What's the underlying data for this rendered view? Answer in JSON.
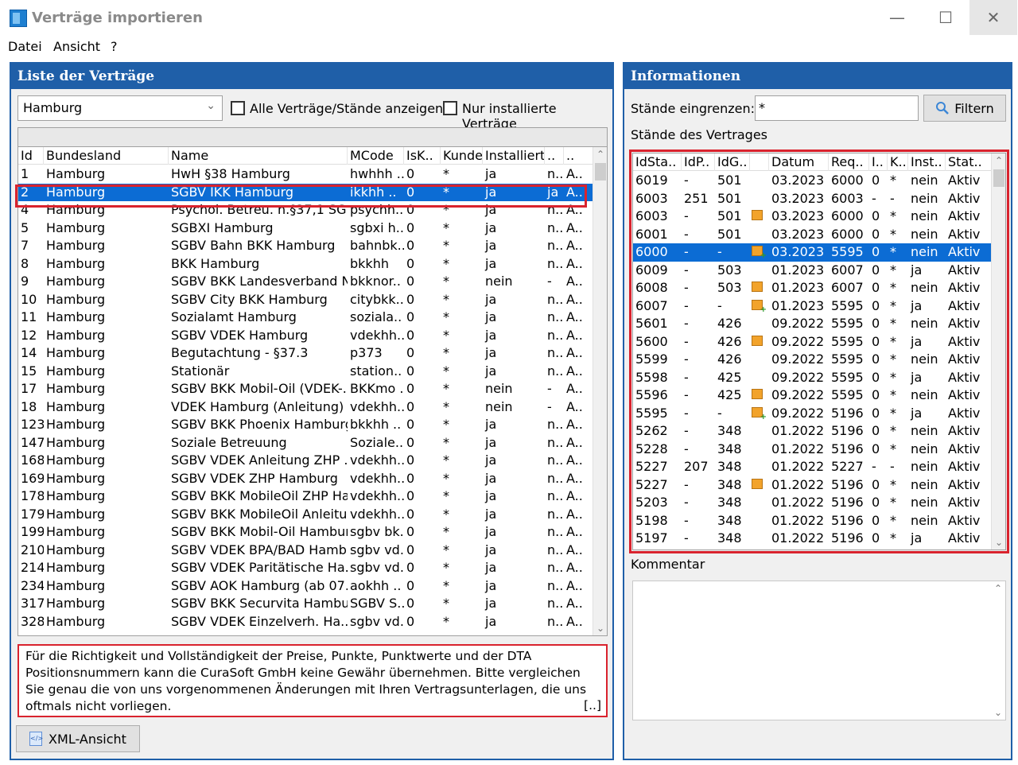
{
  "window": {
    "title": "Verträge importieren",
    "minimize": "—",
    "maximize": "☐",
    "close": "✕"
  },
  "menu": [
    "Datei",
    "Ansicht",
    "?"
  ],
  "left": {
    "header": "Liste der Verträge",
    "state_value": "Hamburg",
    "chk_all_label": "Alle Verträge/Stände anzeigen",
    "chk_installed_label": "Nur installierte Verträge",
    "columns": [
      "Id",
      "Bundesland",
      "Name",
      "MCode",
      "IsK..",
      "Kunde",
      "Installiert",
      "..",
      ".."
    ],
    "rows": [
      [
        "1",
        "Hamburg",
        "HwH §38 Hamburg",
        "hwhhh ..",
        "0",
        "*",
        "ja",
        "n..",
        "A.."
      ],
      [
        "2",
        "Hamburg",
        "SGBV IKK Hamburg",
        "ikkhh ..",
        "0",
        "*",
        "ja",
        "ja",
        "A.."
      ],
      [
        "4",
        "Hamburg",
        "Psychol. Betreu. n.§37,1 SG..",
        "psychh..",
        "0",
        "*",
        "ja",
        "n..",
        "A.."
      ],
      [
        "5",
        "Hamburg",
        "SGBXI Hamburg",
        "sgbxi h..",
        "0",
        "*",
        "ja",
        "n..",
        "A.."
      ],
      [
        "7",
        "Hamburg",
        "SGBV Bahn BKK Hamburg",
        "bahnbk..",
        "0",
        "*",
        "ja",
        "n..",
        "A.."
      ],
      [
        "8",
        "Hamburg",
        "BKK Hamburg",
        "bkkhh",
        "0",
        "*",
        "ja",
        "n..",
        "A.."
      ],
      [
        "9",
        "Hamburg",
        "SGBV BKK Landesverband N..",
        "bkknor..",
        "0",
        "*",
        "nein",
        "-",
        "A.."
      ],
      [
        "10",
        "Hamburg",
        "SGBV City BKK Hamburg",
        "citybkk..",
        "0",
        "*",
        "ja",
        "n..",
        "A.."
      ],
      [
        "11",
        "Hamburg",
        "Sozialamt Hamburg",
        "soziala..",
        "0",
        "*",
        "ja",
        "n..",
        "A.."
      ],
      [
        "12",
        "Hamburg",
        "SGBV VDEK Hamburg",
        "vdekhh..",
        "0",
        "*",
        "ja",
        "n..",
        "A.."
      ],
      [
        "14",
        "Hamburg",
        "Begutachtung - §37.3",
        "p373",
        "0",
        "*",
        "ja",
        "n..",
        "A.."
      ],
      [
        "15",
        "Hamburg",
        "Stationär",
        "station..",
        "0",
        "*",
        "ja",
        "n..",
        "A.."
      ],
      [
        "17",
        "Hamburg",
        "SGBV BKK Mobil-Oil (VDEK-..",
        "BKKmo ..",
        "0",
        "*",
        "nein",
        "-",
        "A.."
      ],
      [
        "18",
        "Hamburg",
        "VDEK Hamburg (Anleitung)",
        "vdekhh..",
        "0",
        "*",
        "nein",
        "-",
        "A.."
      ],
      [
        "123",
        "Hamburg",
        "SGBV BKK Phoenix Hamburg",
        "bkkhh ..",
        "0",
        "*",
        "ja",
        "n..",
        "A.."
      ],
      [
        "147",
        "Hamburg",
        "Soziale Betreuung",
        "Soziale..",
        "0",
        "*",
        "ja",
        "n..",
        "A.."
      ],
      [
        "168",
        "Hamburg",
        "SGBV VDEK Anleitung ZHP ..",
        "vdekhh..",
        "0",
        "*",
        "ja",
        "n..",
        "A.."
      ],
      [
        "169",
        "Hamburg",
        "SGBV VDEK ZHP Hamburg",
        "vdekhh..",
        "0",
        "*",
        "ja",
        "n..",
        "A.."
      ],
      [
        "178",
        "Hamburg",
        "SGBV BKK MobileOil ZHP Ha..",
        "vdekhh..",
        "0",
        "*",
        "ja",
        "n..",
        "A.."
      ],
      [
        "179",
        "Hamburg",
        "SGBV BKK MobileOil Anleitu..",
        "vdekhh..",
        "0",
        "*",
        "ja",
        "n..",
        "A.."
      ],
      [
        "199",
        "Hamburg",
        "SGBV BKK Mobil-Oil Hamburg",
        "sgbv bk..",
        "0",
        "*",
        "ja",
        "n..",
        "A.."
      ],
      [
        "210",
        "Hamburg",
        "SGBV VDEK BPA/BAD Hamb..",
        "sgbv vd..",
        "0",
        "*",
        "ja",
        "n..",
        "A.."
      ],
      [
        "214",
        "Hamburg",
        "SGBV VDEK Paritätische Ha..",
        "sgbv vd..",
        "0",
        "*",
        "ja",
        "n..",
        "A.."
      ],
      [
        "234",
        "Hamburg",
        "SGBV AOK Hamburg (ab 07..",
        "aokhh ..",
        "0",
        "*",
        "ja",
        "n..",
        "A.."
      ],
      [
        "317",
        "Hamburg",
        "SGBV BKK Securvita Hambu..",
        "SGBV S..",
        "0",
        "*",
        "ja",
        "n..",
        "A.."
      ],
      [
        "328",
        "Hamburg",
        "SGBV VDEK Einzelverh. Ha..",
        "sgbv vd..",
        "0",
        "*",
        "ja",
        "n..",
        "A.."
      ]
    ],
    "disclaimer": "Für die Richtigkeit und Vollständigkeit der Preise, Punkte, Punktwerte und der DTA Positionsnummern kann die CuraSoft GmbH keine Gewähr übernehmen. Bitte vergleichen Sie genau die von uns vorgenommenen Änderungen mit Ihren Vertragsunterlagen, die uns oftmals nicht vorliegen.",
    "disclaimer_more": "[..]",
    "xml_button": "XML-Ansicht"
  },
  "right": {
    "header": "Informationen",
    "filter_label": "Stände eingrenzen:",
    "filter_value": "*",
    "filter_button": "Filtern",
    "versions_label": "Stände des Vertrages",
    "columns": [
      "IdSta..",
      "IdP..",
      "IdG..",
      "",
      "Datum",
      "Req..",
      "I..",
      "K..",
      "Inst..",
      "Stat.."
    ],
    "rows": [
      [
        "6019",
        "-",
        "501",
        "",
        "03.2023",
        "6000",
        "0",
        "*",
        "nein",
        "Aktiv"
      ],
      [
        "6003",
        "251",
        "501",
        "",
        "03.2023",
        "6003",
        "-",
        "-",
        "nein",
        "Aktiv"
      ],
      [
        "6003",
        "-",
        "501",
        "pkg",
        "03.2023",
        "6000",
        "0",
        "*",
        "nein",
        "Aktiv"
      ],
      [
        "6001",
        "-",
        "501",
        "",
        "03.2023",
        "6000",
        "0",
        "*",
        "nein",
        "Aktiv"
      ],
      [
        "6000",
        "-",
        "-",
        "pkg+",
        "03.2023",
        "5595",
        "0",
        "*",
        "nein",
        "Aktiv"
      ],
      [
        "6009",
        "-",
        "503",
        "",
        "01.2023",
        "6007",
        "0",
        "*",
        "ja",
        "Aktiv"
      ],
      [
        "6008",
        "-",
        "503",
        "pkg",
        "01.2023",
        "6007",
        "0",
        "*",
        "nein",
        "Aktiv"
      ],
      [
        "6007",
        "-",
        "-",
        "pkg+",
        "01.2023",
        "5595",
        "0",
        "*",
        "ja",
        "Aktiv"
      ],
      [
        "5601",
        "-",
        "426",
        "",
        "09.2022",
        "5595",
        "0",
        "*",
        "nein",
        "Aktiv"
      ],
      [
        "5600",
        "-",
        "426",
        "pkg",
        "09.2022",
        "5595",
        "0",
        "*",
        "ja",
        "Aktiv"
      ],
      [
        "5599",
        "-",
        "426",
        "",
        "09.2022",
        "5595",
        "0",
        "*",
        "nein",
        "Aktiv"
      ],
      [
        "5598",
        "-",
        "425",
        "",
        "09.2022",
        "5595",
        "0",
        "*",
        "ja",
        "Aktiv"
      ],
      [
        "5596",
        "-",
        "425",
        "pkg",
        "09.2022",
        "5595",
        "0",
        "*",
        "nein",
        "Aktiv"
      ],
      [
        "5595",
        "-",
        "-",
        "pkg+",
        "09.2022",
        "5196",
        "0",
        "*",
        "ja",
        "Aktiv"
      ],
      [
        "5262",
        "-",
        "348",
        "",
        "01.2022",
        "5196",
        "0",
        "*",
        "nein",
        "Aktiv"
      ],
      [
        "5228",
        "-",
        "348",
        "",
        "01.2022",
        "5196",
        "0",
        "*",
        "nein",
        "Aktiv"
      ],
      [
        "5227",
        "207",
        "348",
        "",
        "01.2022",
        "5227",
        "-",
        "-",
        "nein",
        "Aktiv"
      ],
      [
        "5227",
        "-",
        "348",
        "pkg",
        "01.2022",
        "5196",
        "0",
        "*",
        "nein",
        "Aktiv"
      ],
      [
        "5203",
        "-",
        "348",
        "",
        "01.2022",
        "5196",
        "0",
        "*",
        "nein",
        "Aktiv"
      ],
      [
        "5198",
        "-",
        "348",
        "",
        "01.2022",
        "5196",
        "0",
        "*",
        "nein",
        "Aktiv"
      ],
      [
        "5197",
        "-",
        "348",
        "",
        "01.2022",
        "5196",
        "0",
        "*",
        "ja",
        "Aktiv"
      ]
    ],
    "comment_label": "Kommentar"
  },
  "colors": {
    "accent": "#1f5fa8",
    "selection": "#0c6cd4",
    "highlight": "#d9232e"
  }
}
